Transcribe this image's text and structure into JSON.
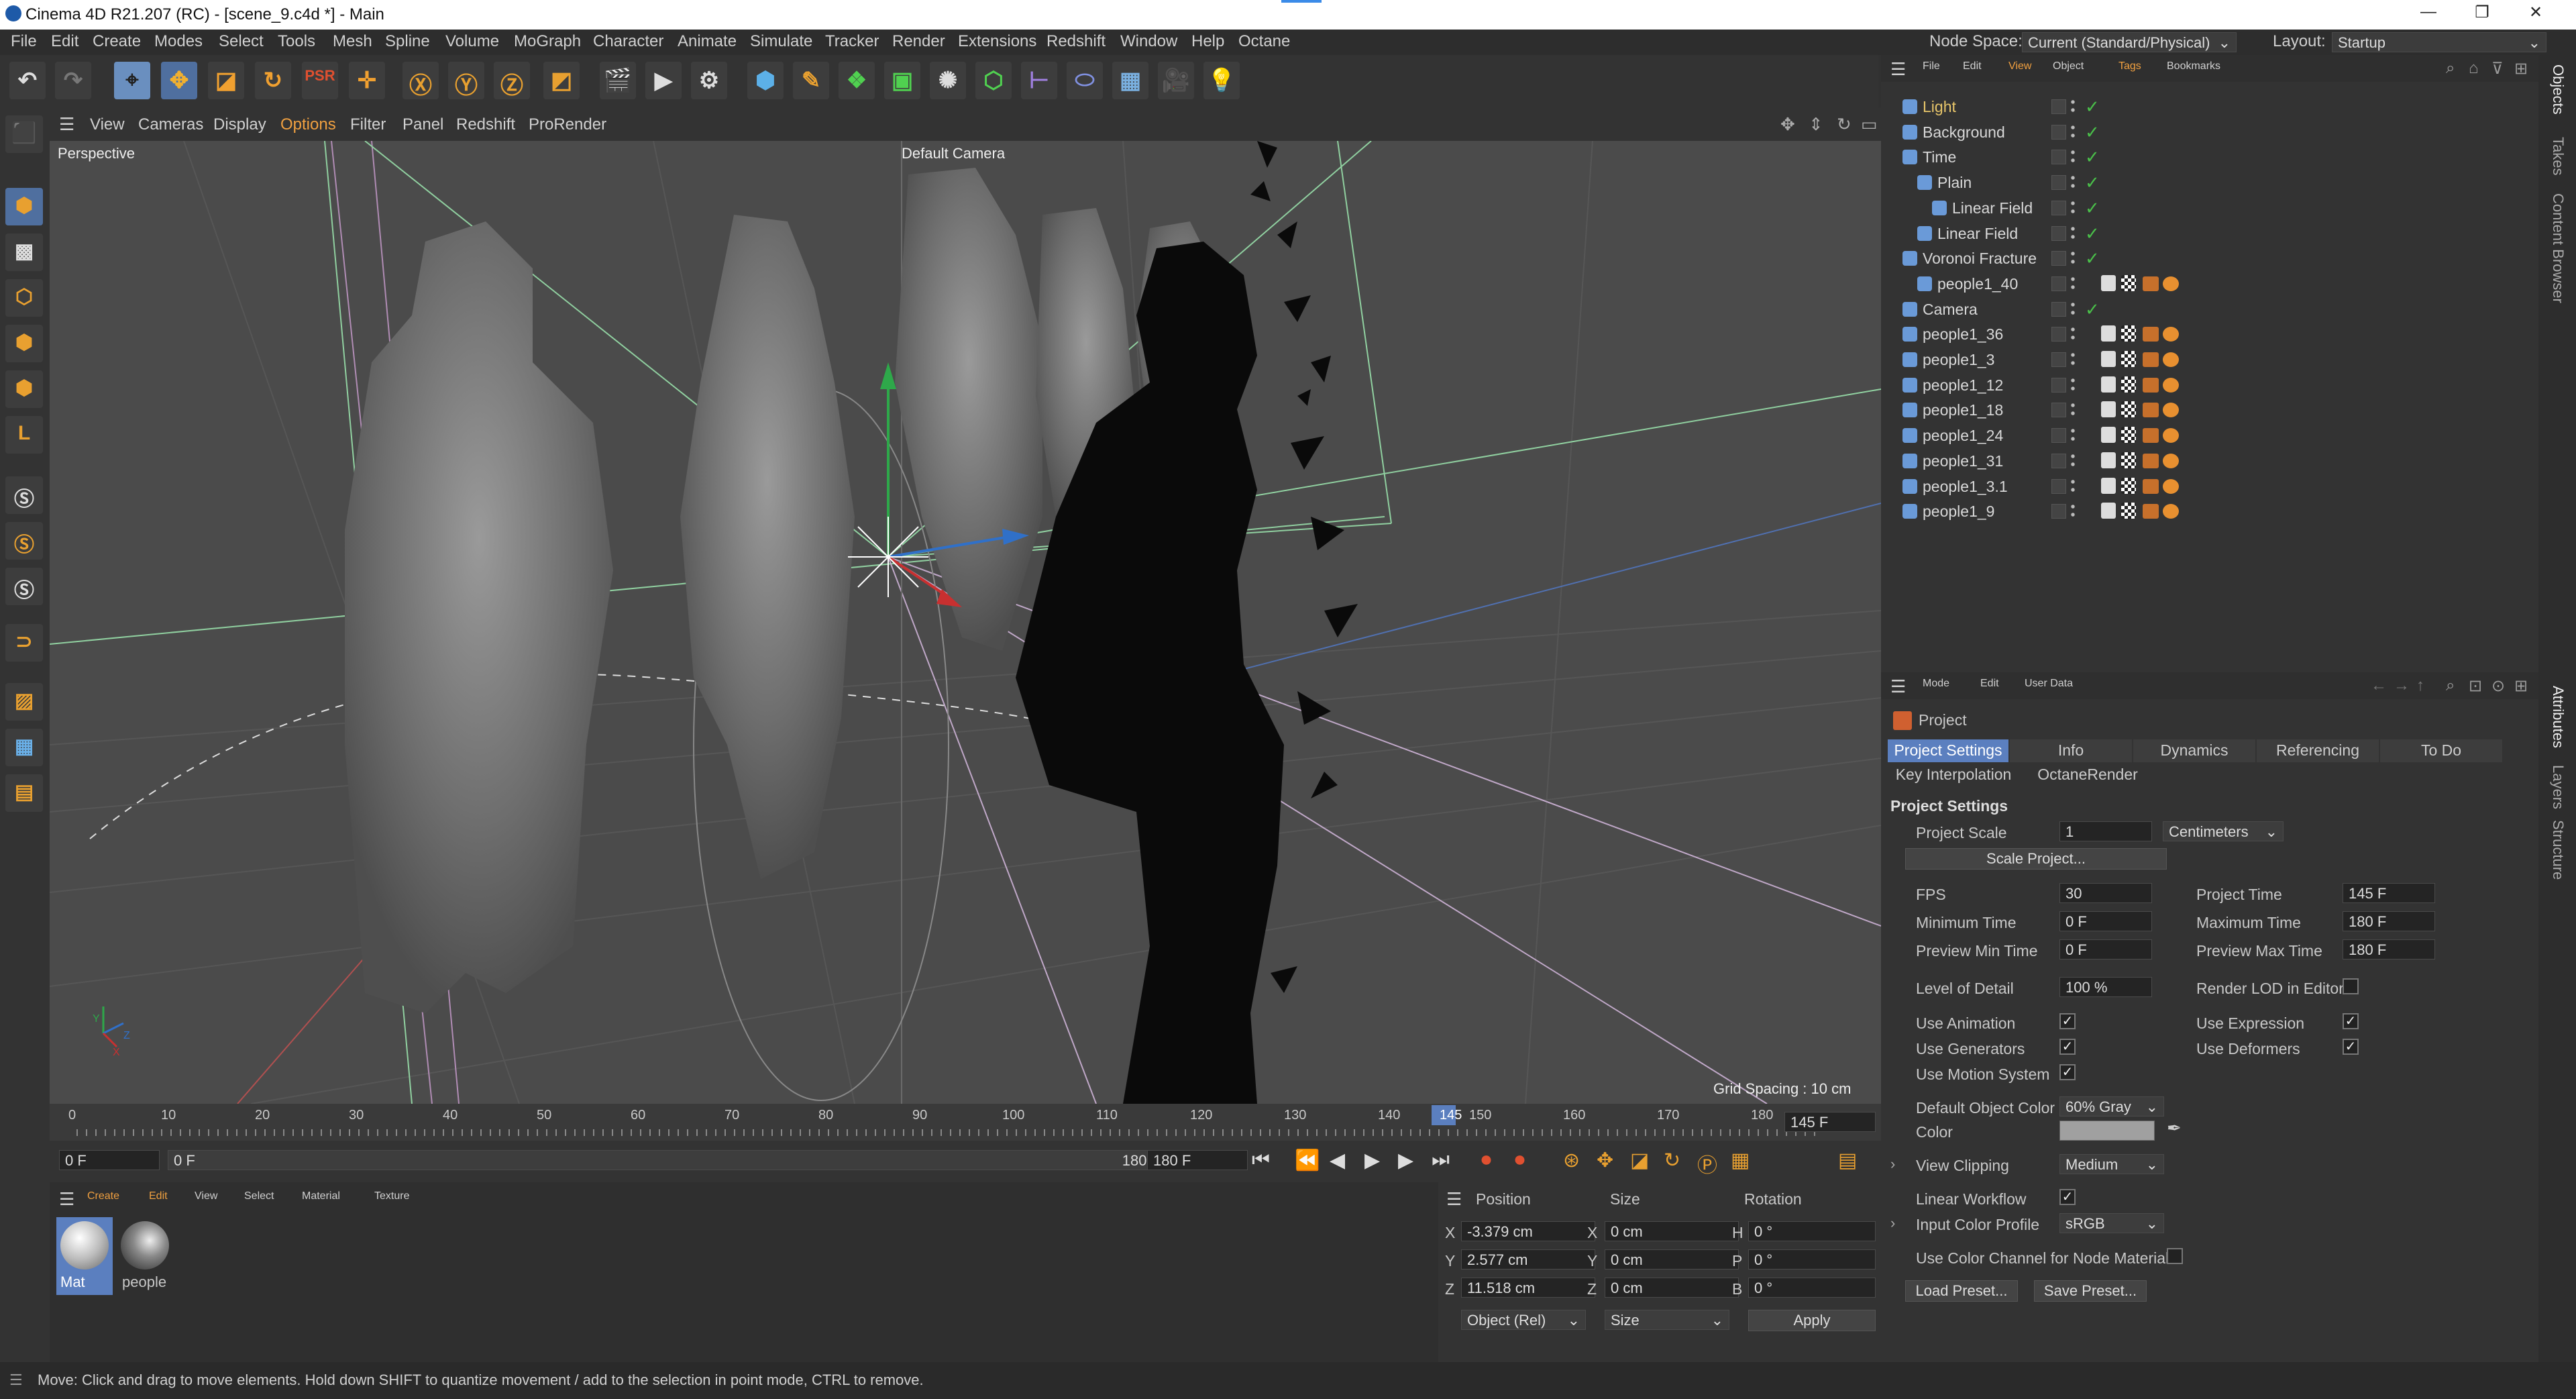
{
  "titlebar": {
    "title": "Cinema 4D R21.207 (RC) - [scene_9.c4d *] - Main"
  },
  "menubar": {
    "items": [
      "File",
      "Edit",
      "Create",
      "Modes",
      "Select",
      "Tools",
      "Mesh",
      "Spline",
      "Volume",
      "MoGraph",
      "Character",
      "Animate",
      "Simulate",
      "Tracker",
      "Render",
      "Extensions",
      "Redshift",
      "Window",
      "Help",
      "Octane"
    ],
    "node_space_label": "Node Space:",
    "node_space_value": "Current (Standard/Physical)",
    "layout_label": "Layout:",
    "layout_value": "Startup"
  },
  "viewport": {
    "menu": [
      "View",
      "Cameras",
      "Display",
      "Options",
      "Filter",
      "Panel",
      "Redshift",
      "ProRender"
    ],
    "view_name": "Perspective",
    "camera_name": "Default Camera",
    "grid_spacing": "Grid Spacing : 10 cm",
    "axis_labels": [
      "Y",
      "Z",
      "X"
    ]
  },
  "timeline": {
    "ticks": [
      "0",
      "10",
      "20",
      "30",
      "40",
      "50",
      "60",
      "70",
      "80",
      "90",
      "100",
      "110",
      "120",
      "130",
      "140",
      "145",
      "150",
      "160",
      "170",
      "180"
    ],
    "current_frame_field": "145 F",
    "start_field": "0 F",
    "range_start": "0 F",
    "range_end": "180 F",
    "end_field": "180 F"
  },
  "materials": {
    "menu": [
      "Create",
      "Edit",
      "View",
      "Select",
      "Material",
      "Texture"
    ],
    "items": [
      "Mat",
      "people"
    ]
  },
  "coordinates": {
    "headers": [
      "Position",
      "Size",
      "Rotation"
    ],
    "rows": [
      {
        "axis": "X",
        "pos": "-3.379 cm",
        "saxis": "X",
        "size": "0 cm",
        "raxis": "H",
        "rot": "0 °"
      },
      {
        "axis": "Y",
        "pos": "2.577 cm",
        "saxis": "Y",
        "size": "0 cm",
        "raxis": "P",
        "rot": "0 °"
      },
      {
        "axis": "Z",
        "pos": "11.518 cm",
        "saxis": "Z",
        "size": "0 cm",
        "raxis": "B",
        "rot": "0 °"
      }
    ],
    "mode_select": "Object (Rel)",
    "size_select": "Size",
    "apply_label": "Apply"
  },
  "status": {
    "text": "Move: Click and drag to move elements. Hold down SHIFT to quantize movement / add to the selection in point mode, CTRL to remove."
  },
  "objects": {
    "menu": [
      "File",
      "Edit",
      "View",
      "Object",
      "Tags",
      "Bookmarks"
    ],
    "items": [
      {
        "name": "Light",
        "color": "#e8c66a",
        "indent": 0,
        "tags": 0
      },
      {
        "name": "Background",
        "color": "#d8d8d8",
        "indent": 0,
        "tags": 0
      },
      {
        "name": "Time",
        "color": "#d8d8d8",
        "indent": 0,
        "tags": 0
      },
      {
        "name": "Plain",
        "color": "#d8d8d8",
        "indent": 1,
        "tags": 0
      },
      {
        "name": "Linear Field",
        "color": "#d8d8d8",
        "indent": 2,
        "tags": 0
      },
      {
        "name": "Linear Field",
        "color": "#d8d8d8",
        "indent": 1,
        "tags": 0
      },
      {
        "name": "Voronoi Fracture",
        "color": "#d8d8d8",
        "indent": 0,
        "tags": 0
      },
      {
        "name": "people1_40",
        "color": "#d8d8d8",
        "indent": 1,
        "tags": 1
      },
      {
        "name": "Camera",
        "color": "#d8d8d8",
        "indent": 0,
        "tags": 0
      },
      {
        "name": "people1_36",
        "color": "#d8d8d8",
        "indent": 0,
        "tags": 1
      },
      {
        "name": "people1_3",
        "color": "#d8d8d8",
        "indent": 0,
        "tags": 1
      },
      {
        "name": "people1_12",
        "color": "#d8d8d8",
        "indent": 0,
        "tags": 1
      },
      {
        "name": "people1_18",
        "color": "#d8d8d8",
        "indent": 0,
        "tags": 1
      },
      {
        "name": "people1_24",
        "color": "#d8d8d8",
        "indent": 0,
        "tags": 1
      },
      {
        "name": "people1_31",
        "color": "#d8d8d8",
        "indent": 0,
        "tags": 1
      },
      {
        "name": "people1_3.1",
        "color": "#d8d8d8",
        "indent": 0,
        "tags": 1
      },
      {
        "name": "people1_9",
        "color": "#d8d8d8",
        "indent": 0,
        "tags": 1
      }
    ]
  },
  "attributes": {
    "menu": [
      "Mode",
      "Edit",
      "User Data"
    ],
    "object_name": "Project",
    "tabs": [
      "Project Settings",
      "Info",
      "Dynamics",
      "Referencing",
      "To Do"
    ],
    "tabs2": [
      "Key Interpolation",
      "OctaneRender"
    ],
    "section": "Project Settings",
    "project_scale_label": "Project Scale",
    "project_scale_value": "1",
    "project_scale_unit": "Centimeters",
    "scale_project_button": "Scale Project...",
    "fps_label": "FPS",
    "fps_value": "30",
    "project_time_label": "Project Time",
    "project_time_value": "145 F",
    "min_time_label": "Minimum Time",
    "min_time_value": "0 F",
    "max_time_label": "Maximum Time",
    "max_time_value": "180 F",
    "prev_min_label": "Preview Min Time",
    "prev_min_value": "0 F",
    "prev_max_label": "Preview Max Time",
    "prev_max_value": "180 F",
    "lod_label": "Level of Detail",
    "lod_value": "100 %",
    "render_lod_label": "Render LOD in Editor",
    "use_animation_label": "Use Animation",
    "use_expression_label": "Use Expression",
    "use_generators_label": "Use Generators",
    "use_deformers_label": "Use Deformers",
    "use_motion_label": "Use Motion System",
    "default_color_label": "Default Object Color",
    "default_color_value": "60% Gray",
    "color_label": "Color",
    "view_clipping_label": "View Clipping",
    "view_clipping_value": "Medium",
    "linear_workflow_label": "Linear Workflow",
    "input_profile_label": "Input Color Profile",
    "input_profile_value": "sRGB",
    "use_color_channel_label": "Use Color Channel for Node Material",
    "load_preset": "Load Preset...",
    "save_preset": "Save Preset..."
  },
  "right_tabs": [
    "Objects",
    "Takes",
    "Content Browser",
    "Attributes",
    "Layers",
    "Structure"
  ]
}
